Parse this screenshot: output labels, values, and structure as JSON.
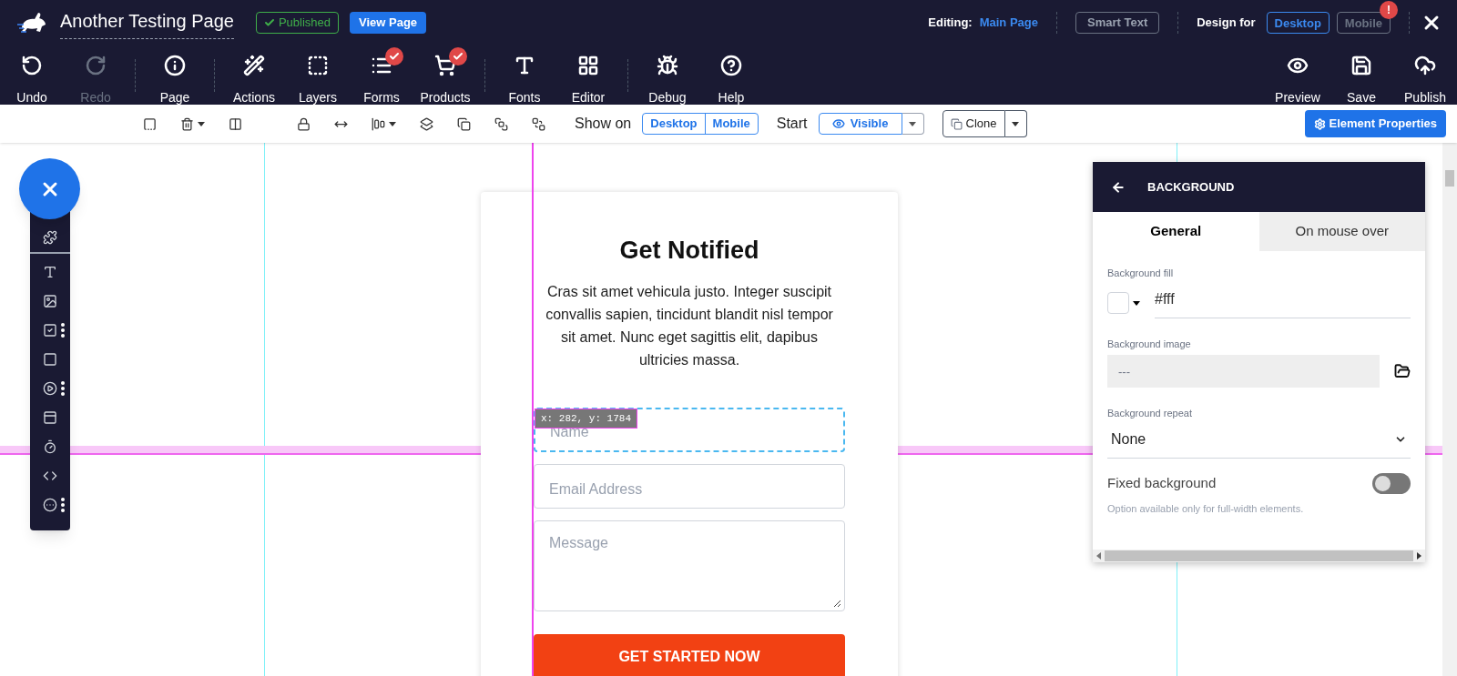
{
  "header": {
    "title": "Another Testing Page",
    "published_badge": "Published",
    "view_page_button": "View Page",
    "editing_label": "Editing:",
    "editing_value": "Main Page",
    "smart_text_button": "Smart Text",
    "design_for_label": "Design for",
    "design_for": [
      {
        "label": "Desktop",
        "selected": true
      },
      {
        "label": "Mobile",
        "selected": false,
        "alert": "!"
      }
    ]
  },
  "main_toolbar": {
    "left": [
      {
        "label": "Undo",
        "disabled": false,
        "checked": false
      },
      {
        "label": "Redo",
        "disabled": true,
        "checked": false
      },
      {
        "label": "Page",
        "disabled": false,
        "checked": false
      },
      {
        "label": "Actions",
        "disabled": false,
        "checked": false
      },
      {
        "label": "Layers",
        "disabled": false,
        "checked": false
      },
      {
        "label": "Forms",
        "disabled": false,
        "checked": true
      },
      {
        "label": "Products",
        "disabled": false,
        "checked": true
      },
      {
        "label": "Fonts",
        "disabled": false,
        "checked": false
      },
      {
        "label": "Editor",
        "disabled": false,
        "checked": false
      },
      {
        "label": "Debug",
        "disabled": false,
        "checked": false
      },
      {
        "label": "Help",
        "disabled": false,
        "checked": false
      }
    ],
    "right": [
      {
        "label": "Preview"
      },
      {
        "label": "Save"
      },
      {
        "label": "Publish"
      }
    ]
  },
  "element_toolbar": {
    "show_on_label": "Show on",
    "show_on": [
      "Desktop",
      "Mobile"
    ],
    "start_label": "Start",
    "start_value": "Visible",
    "clone_button": "Clone",
    "properties_button": "Element Properties"
  },
  "form_card": {
    "heading": "Get Notified",
    "body": "Cras sit amet vehicula justo. Integer suscipit convallis sapien, tincidunt blandit nisl tempor sit amet. Nunc eget sagittis elit, dapibus ultricies massa.",
    "coordinates": "x: 282, y: 1784",
    "fields": [
      {
        "kind": "input",
        "placeholder": "Name",
        "selected": true
      },
      {
        "kind": "input",
        "placeholder": "Email Address",
        "selected": false
      },
      {
        "kind": "textarea",
        "placeholder": "Message",
        "selected": false
      }
    ],
    "submit_button": "GET STARTED NOW"
  },
  "panel": {
    "title": "BACKGROUND",
    "tabs": [
      {
        "label": "General",
        "selected": true
      },
      {
        "label": "On mouse over",
        "selected": false
      }
    ],
    "fill_label": "Background fill",
    "fill_value": "#fff",
    "image_label": "Background image",
    "image_placeholder": "---",
    "repeat_label": "Background repeat",
    "repeat_value": "None",
    "fixed_label": "Fixed background",
    "fixed_on": false,
    "fixed_hint": "Option available only for full-width elements."
  }
}
